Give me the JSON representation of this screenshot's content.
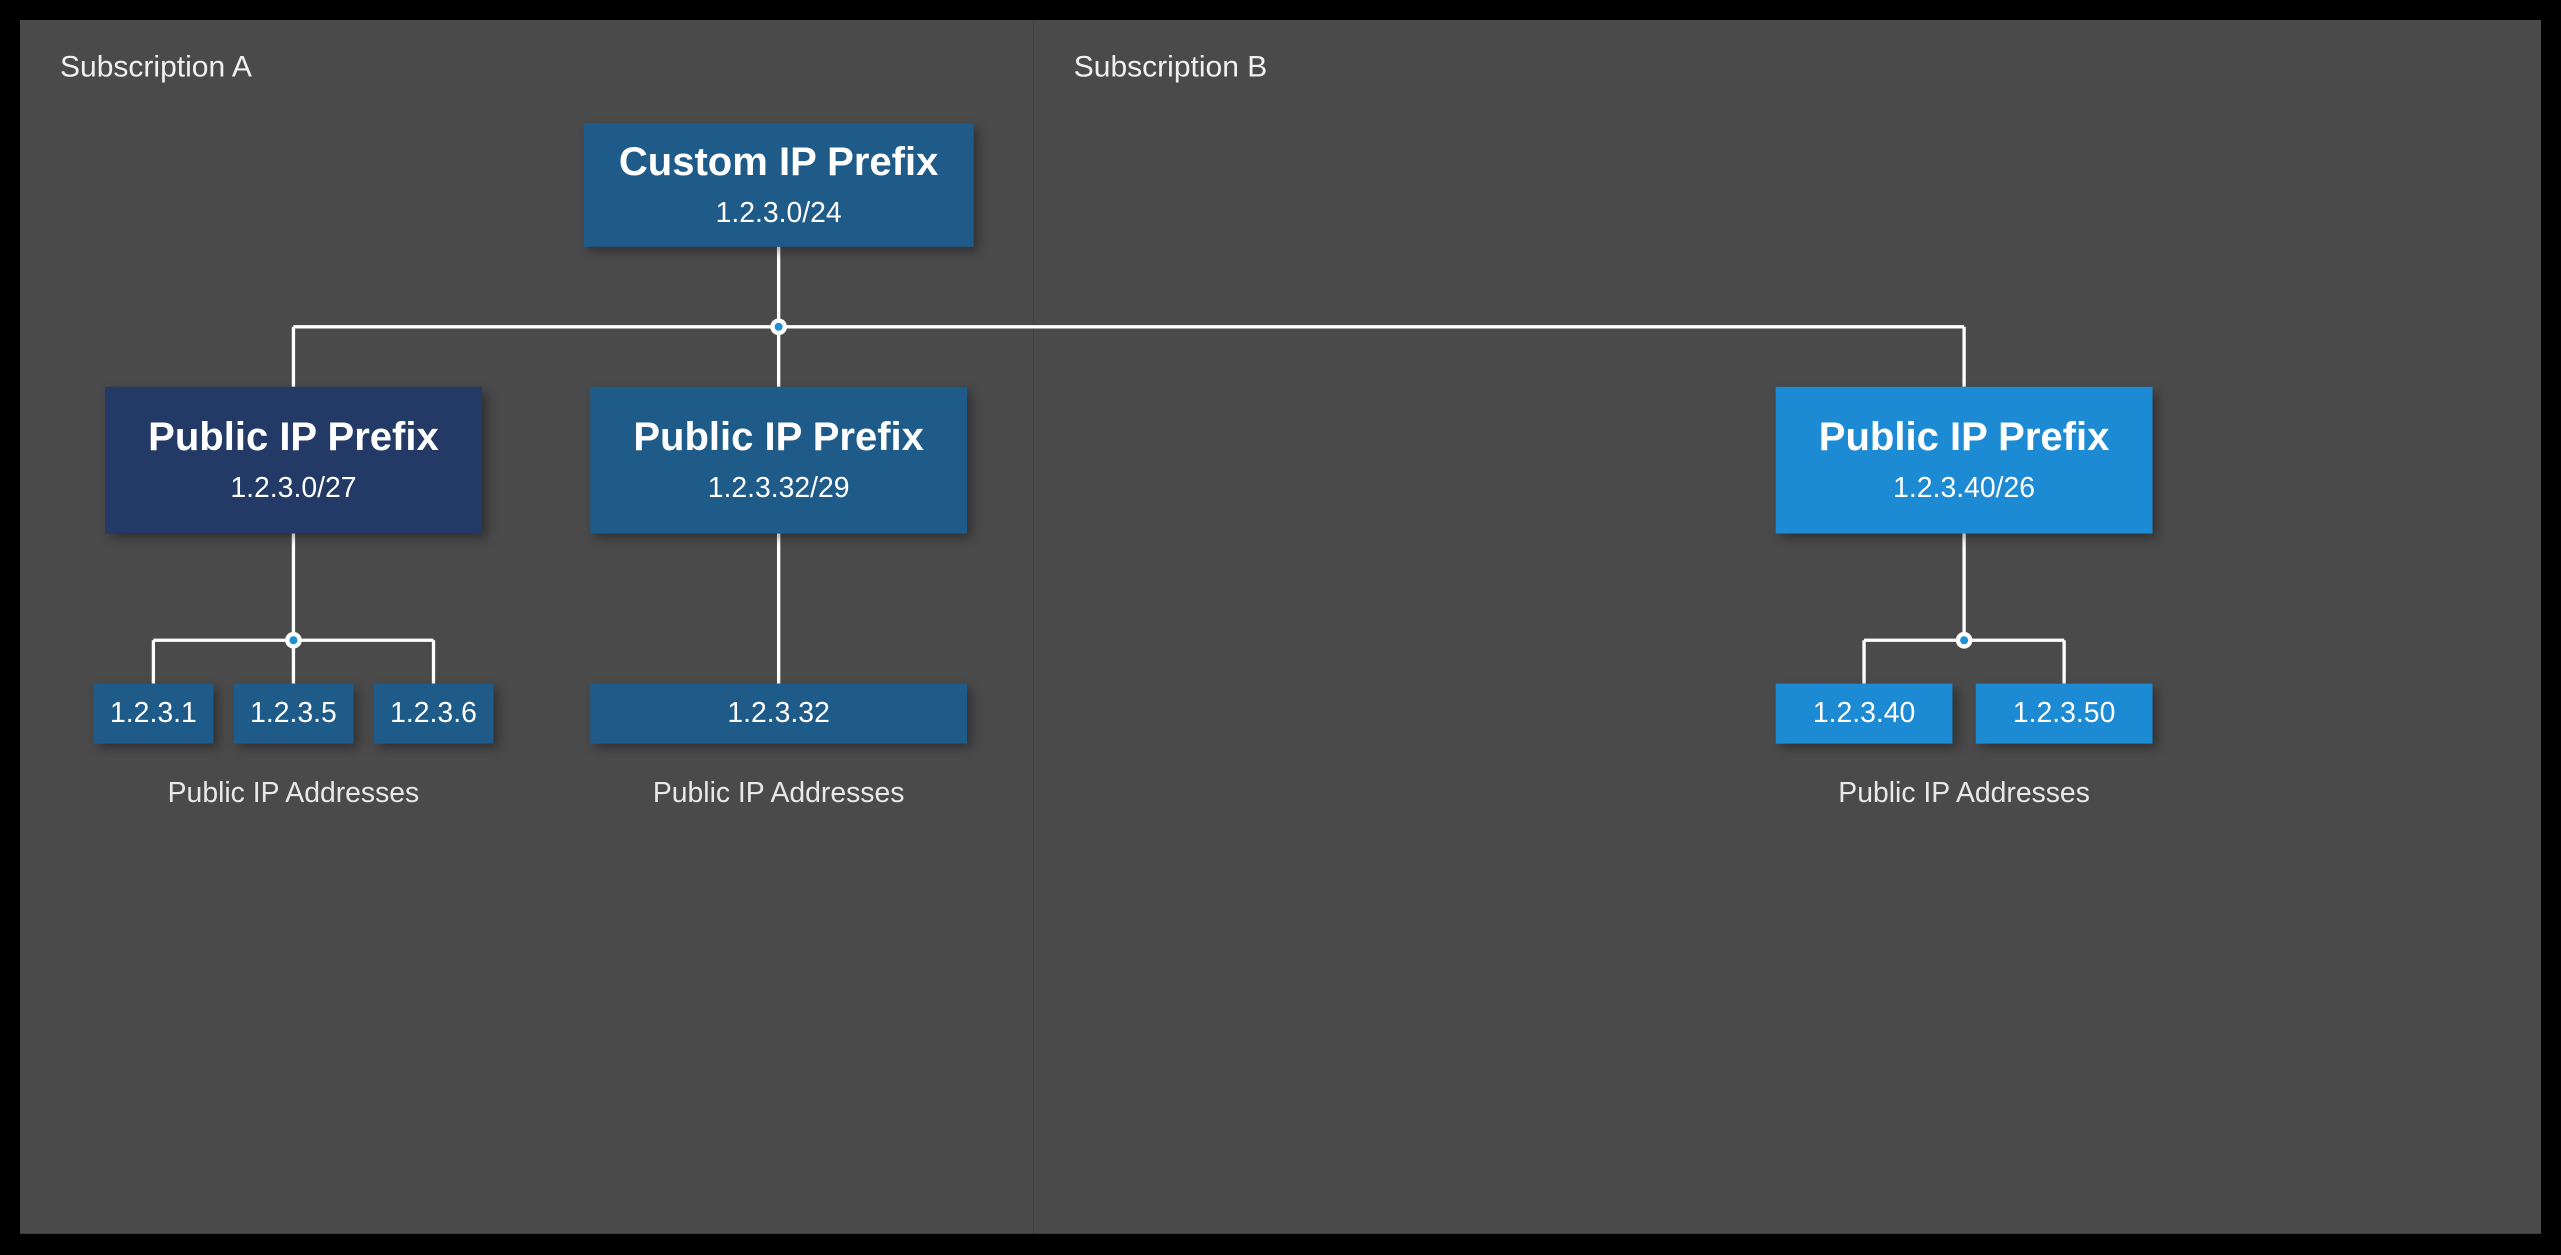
{
  "subscriptions": {
    "a": {
      "title": "Subscription A"
    },
    "b": {
      "title": "Subscription B"
    }
  },
  "custom_prefix": {
    "title": "Custom IP Prefix",
    "cidr": "1.2.3.0/24",
    "color": "#1f5b89"
  },
  "public_prefixes": [
    {
      "title": "Public IP Prefix",
      "cidr": "1.2.3.0/27",
      "color": "#233a66",
      "addresses": [
        "1.2.3.1",
        "1.2.3.5",
        "1.2.3.6"
      ],
      "addr_color": "#1f5b89",
      "caption": "Public IP Addresses"
    },
    {
      "title": "Public IP Prefix",
      "cidr": "1.2.3.32/29",
      "color": "#1f5b89",
      "addresses": [
        "1.2.3.32"
      ],
      "addr_color": "#1f5b89",
      "caption": "Public IP Addresses"
    },
    {
      "title": "Public IP Prefix",
      "cidr": "1.2.3.40/26",
      "color": "#1d8bd4",
      "addresses": [
        "1.2.3.40",
        "1.2.3.50"
      ],
      "addr_color": "#1d8bd4",
      "caption": "Public IP Addresses"
    }
  ]
}
